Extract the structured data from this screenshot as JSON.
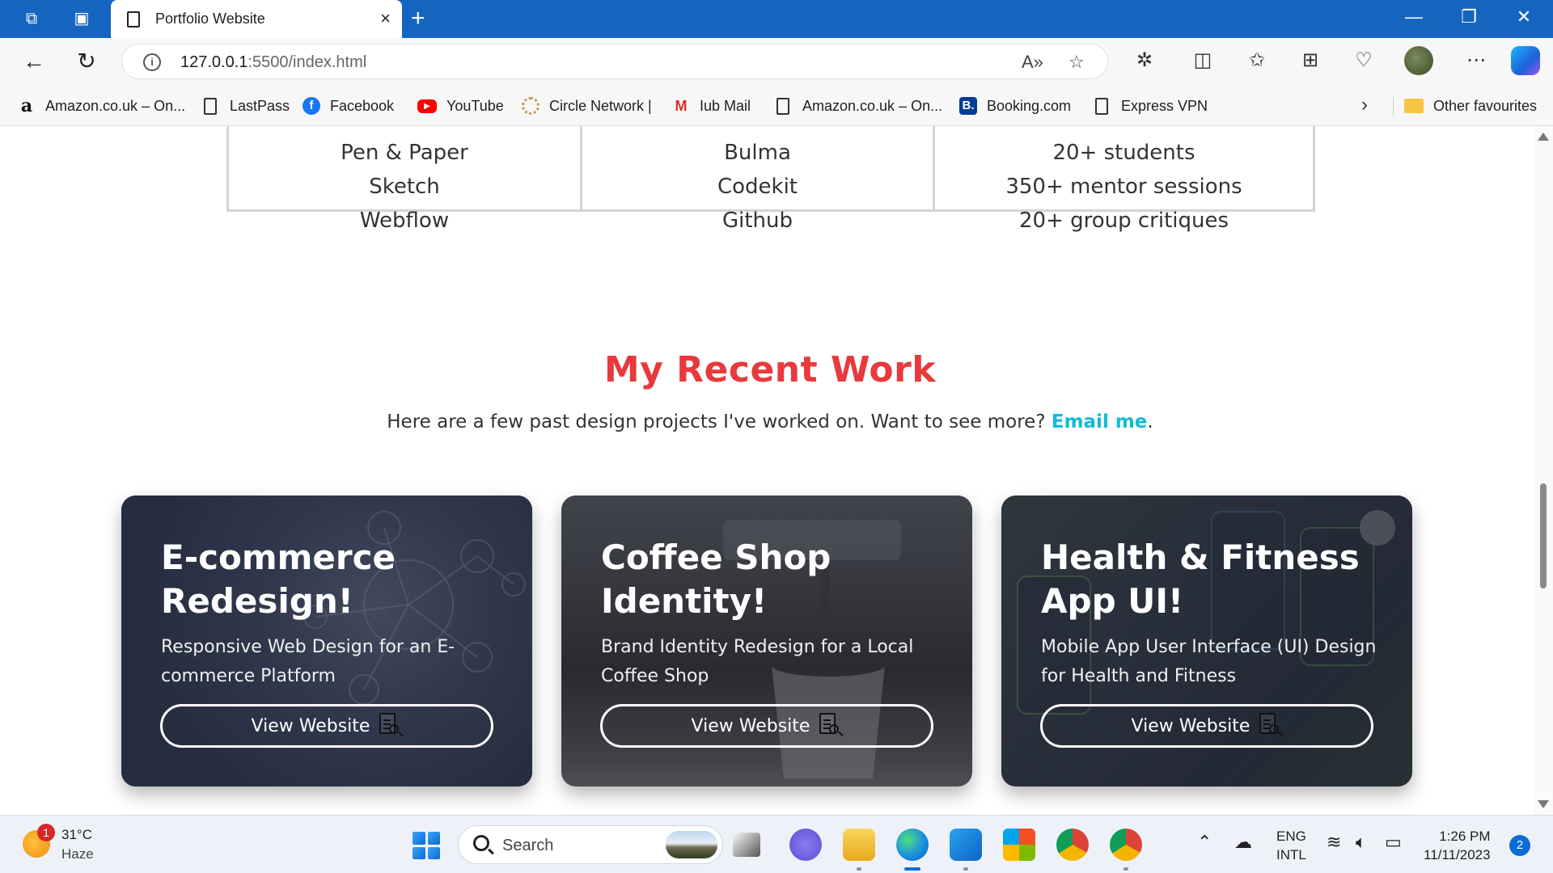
{
  "browser": {
    "tab_title": "Portfolio Website",
    "tab_close": "×",
    "new_tab": "+",
    "url_host": "127.0.0.1",
    "url_rest": ":5500/index.html",
    "favourites": [
      {
        "label": "Amazon.co.uk – On...",
        "icon": "amazon-icon",
        "glyph": "a"
      },
      {
        "label": "LastPass",
        "icon": "document-icon",
        "glyph": ""
      },
      {
        "label": "Facebook",
        "icon": "facebook-icon",
        "glyph": "f"
      },
      {
        "label": "YouTube",
        "icon": "youtube-icon",
        "glyph": "▶"
      },
      {
        "label": "Circle Network |",
        "icon": "circle-network-icon",
        "glyph": ""
      },
      {
        "label": "Iub Mail",
        "icon": "gmail-icon",
        "glyph": "M"
      },
      {
        "label": "Amazon.co.uk – On...",
        "icon": "document-icon",
        "glyph": ""
      },
      {
        "label": "Booking.com",
        "icon": "booking-icon",
        "glyph": "B."
      },
      {
        "label": "Express VPN",
        "icon": "document-icon",
        "glyph": ""
      }
    ],
    "other_favourites": "Other favourites"
  },
  "skills": {
    "columns": [
      [
        "Pen & Paper",
        "Sketch",
        "Webflow"
      ],
      [
        "Bulma",
        "Codekit",
        "Github"
      ],
      [
        "20+ students",
        "350+ mentor sessions",
        "20+ group critiques"
      ]
    ]
  },
  "work": {
    "title": "My Recent Work",
    "subtitle_text": "Here are a few past design projects I've worked on. Want to see more? ",
    "subtitle_link": "Email me",
    "subtitle_end": ".",
    "cards": [
      {
        "title": "E-commerce Redesign!",
        "description": "Responsive Web Design for an E-commerce Platform",
        "button": "View Website"
      },
      {
        "title": "Coffee Shop Identity!",
        "description": "Brand Identity Redesign for a Local Coffee Shop",
        "button": "View Website"
      },
      {
        "title": "Health & Fitness App UI!",
        "description": "Mobile App User Interface (UI) Design for Health and Fitness",
        "button": "View Website"
      }
    ]
  },
  "taskbar": {
    "weather_temp": "31°C",
    "weather_cond": "Haze",
    "weather_badge": "1",
    "search_placeholder": "Search",
    "lang_line1": "ENG",
    "lang_line2": "INTL",
    "time": "1:26 PM",
    "date": "11/11/2023",
    "notifications": "2"
  },
  "colors": {
    "accent_title": "#e8393c",
    "link": "#0fbcd7",
    "titlebar": "#1565c0"
  }
}
